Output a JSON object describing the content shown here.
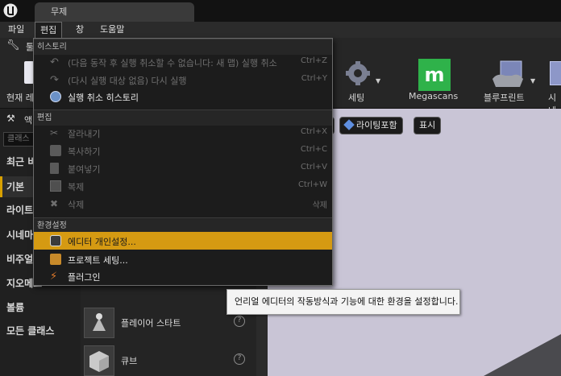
{
  "window": {
    "tab_title": "무제"
  },
  "menubar": {
    "file": "파일",
    "edit": "편집",
    "window": "창",
    "help": "도움말"
  },
  "toolbar": {
    "tool_label_partial": "툴",
    "current_level_partial": "현재 레",
    "settings": "세팅",
    "megascans": "Megascans",
    "blueprint": "블루프린트",
    "cinematics_partial": "시네"
  },
  "left_panel": {
    "place_actors_partial": "액",
    "search_placeholder_partial": "클래스",
    "nav": [
      "최근 비",
      "기본",
      "라이트",
      "시네마",
      "비주얼",
      "지오메트",
      "볼륨",
      "모든 클래스"
    ],
    "place_items": [
      {
        "label": "플레이어 스타트",
        "icon": "player-start-icon"
      },
      {
        "label": "큐브",
        "icon": "cube-icon"
      }
    ]
  },
  "viewport": {
    "lit_button": "라이팅포함",
    "show_button": "표시"
  },
  "edit_menu": {
    "section_history": "히스토리",
    "undo": "(다음 동작 후 실행 취소할 수 없습니다: 새 맵) 실행 취소",
    "undo_shortcut": "Ctrl+Z",
    "redo": "(다시 실행 대상 없음) 다시 실행",
    "redo_shortcut": "Ctrl+Y",
    "undo_history": "실행 취소 히스토리",
    "section_edit": "편집",
    "cut": "잘라내기",
    "cut_shortcut": "Ctrl+X",
    "copy": "복사하기",
    "copy_shortcut": "Ctrl+C",
    "paste": "붙여넣기",
    "paste_shortcut": "Ctrl+V",
    "duplicate": "복제",
    "duplicate_shortcut": "Ctrl+W",
    "delete": "삭제",
    "delete_shortcut": "삭제",
    "section_config": "환경설정",
    "editor_prefs": "에디터 개인설정...",
    "project_settings": "프로젝트 세팅...",
    "plugins": "플러그인"
  },
  "tooltip": "언리얼 에디터의 작동방식과 기능에 대한 환경을 설정합니다.",
  "colors": {
    "highlight": "#d59a12",
    "viewport": "#c9c5d6",
    "megascans": "#2fb24a"
  }
}
